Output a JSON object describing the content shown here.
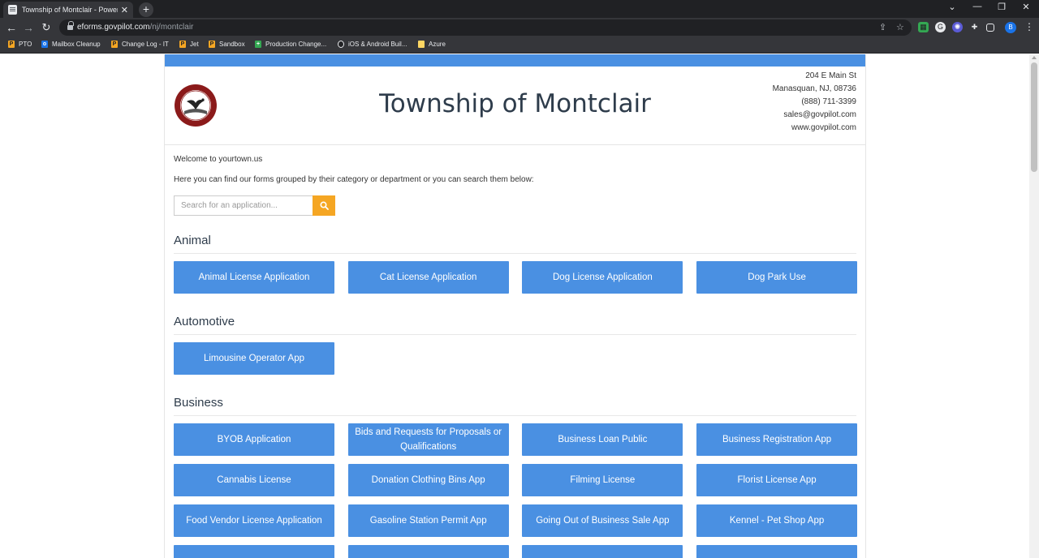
{
  "browser": {
    "tab_title": "Township of Montclair - Powered",
    "url_domain": "eforms.govpilot.com",
    "url_path": "/nj/montclair",
    "profile_initial": "B",
    "bookmarks": [
      {
        "label": "PTO",
        "icon": "bookmark-icon",
        "color": "#f5a623"
      },
      {
        "label": "Mailbox Cleanup",
        "icon": "outlook-icon",
        "color": "#1a73e8"
      },
      {
        "label": "Change Log - IT",
        "icon": "bookmark-icon",
        "color": "#f5a623"
      },
      {
        "label": "Jet",
        "icon": "bookmark-icon",
        "color": "#f5a623"
      },
      {
        "label": "Sandbox",
        "icon": "bookmark-icon",
        "color": "#f5a623"
      },
      {
        "label": "Production Change...",
        "icon": "plus-icon",
        "color": "#34a853"
      },
      {
        "label": "iOS & Android Buil...",
        "icon": "github-icon",
        "color": "#e8eaed"
      },
      {
        "label": "Azure",
        "icon": "folder-icon",
        "color": "#fdd663"
      }
    ]
  },
  "page": {
    "title": "Township of Montclair",
    "contact": {
      "address1": "204 E Main St",
      "address2": "Manasquan, NJ, 08736",
      "phone": "(888) 711-3399",
      "email": "sales@govpilot.com",
      "website": "www.govpilot.com"
    },
    "welcome": "Welcome to yourtown.us",
    "intro": "Here you can find our forms grouped by their category or department or you can search them below:",
    "search": {
      "placeholder": "Search for an application..."
    },
    "colors": {
      "accent": "#4a90e2",
      "search_button": "#f5a623",
      "title": "#2e3c4b"
    }
  },
  "sections": [
    {
      "title": "Animal",
      "buttons": [
        "Animal License Application",
        "Cat License Application",
        "Dog License Application",
        "Dog Park Use"
      ]
    },
    {
      "title": "Automotive",
      "buttons": [
        "Limousine Operator App"
      ]
    },
    {
      "title": "Business",
      "buttons": [
        "BYOB Application",
        "Bids and Requests for Proposals or Qualifications",
        "Business Loan Public",
        "Business Registration App",
        "Cannabis License",
        "Donation Clothing Bins App",
        "Filming License",
        "Florist License App",
        "Food Vendor License Application",
        "Gasoline Station Permit App",
        "Going Out of Business Sale App",
        "Kennel - Pet Shop App"
      ]
    }
  ]
}
